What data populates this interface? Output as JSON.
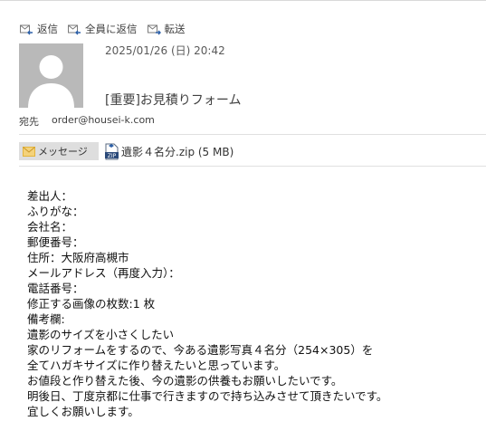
{
  "toolbar": {
    "reply_label": "返信",
    "reply_all_label": "全員に返信",
    "forward_label": "転送"
  },
  "header": {
    "date": "2025/01/26 (日) 20:42",
    "subject": "[重要]お見積りフォーム",
    "to_label": "宛先",
    "to_address": "order@housei-k.com"
  },
  "attachments": {
    "message_tab_label": "メッセージ",
    "file_label": "遺影４名分.zip (5 MB)"
  },
  "body": {
    "lines": [
      "差出人：",
      "ふりがな：",
      "会社名：",
      "郵便番号：",
      "住所：大阪府高槻市",
      "メールアドレス（再度入力）：",
      "電話番号：",
      "修正する画像の枚数:1 枚",
      "備考欄:",
      "遺影のサイズを小さくしたい",
      "家のリフォームをするので、今ある遺影写真４名分（254×305）を",
      "全てハガキサイズに作り替えたいと思っています。",
      "お値段と作り替えた後、今の遺影の供養もお願いしたいです。",
      "明後日、丁度京都に仕事で行きますので持ち込みさせて頂きたいです。",
      "宜しくお願いします。"
    ]
  },
  "colors": {
    "icon_blue": "#2b5fa8",
    "avatar_bg": "#b9b9b9",
    "tab_bg": "#dedede",
    "envelope": "#e3b43c"
  }
}
